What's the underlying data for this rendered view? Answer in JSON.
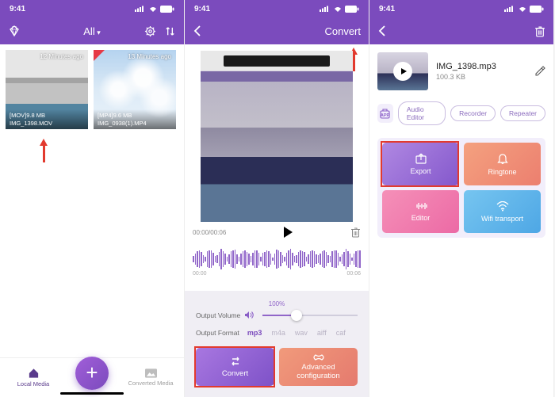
{
  "status": {
    "time": "9:41"
  },
  "screen1": {
    "header": {
      "filter": "All"
    },
    "thumbs": [
      {
        "timeago": "12 Minutes ago",
        "size_line": "[MOV]9.8 MB",
        "name_line": "IMG_1398.MOV"
      },
      {
        "timeago": "13 Minutes ago",
        "size_line": "[MP4]9.6 MB",
        "name_line": "IMG_0938(1).MP4"
      }
    ],
    "nav": {
      "local": "Local Media",
      "converted": "Converted Media"
    }
  },
  "screen2": {
    "header": {
      "action": "Convert"
    },
    "timecode": "00:00/00:06",
    "wave_times": {
      "start": "00:00",
      "end": "00:06"
    },
    "output_volume_label": "Output Volume",
    "volume_pct": "100%",
    "output_format_label": "Output Format",
    "formats": [
      "mp3",
      "m4a",
      "wav",
      "aiff",
      "caf"
    ],
    "active_format_index": 0,
    "actions": {
      "convert": "Convert",
      "advanced": "Advanced\nconfiguration"
    }
  },
  "screen3": {
    "file": {
      "name": "IMG_1398.mp3",
      "size": "100.3 KB"
    },
    "pills": [
      "Audio Editor",
      "Recorder",
      "Repeater"
    ],
    "tiles": {
      "export": "Export",
      "ringtone": "Ringtone",
      "editor": "Editor",
      "wifi": "Wifi transport"
    }
  }
}
